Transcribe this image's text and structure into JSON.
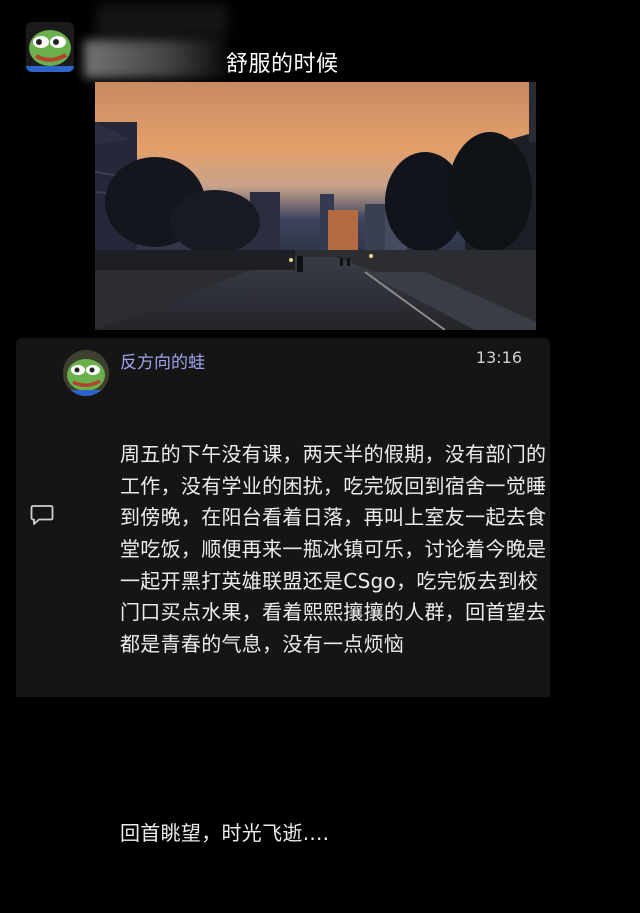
{
  "post": {
    "title_fragment": "舒服的时候",
    "avatar_icon": "pepe-frog-avatar"
  },
  "photo": {
    "description_icon": "sunset-campus-photo"
  },
  "comment": {
    "author": "反方向的蛙",
    "time": "13:16",
    "avatar_icon": "pepe-frog-avatar",
    "action_icon": "comment-icon",
    "paragraphs": [
      "周五的下午没有课，两天半的假期，没有部门的工作，没有学业的困扰，吃完饭回到宿舍一觉睡到傍晚，在阳台看着日落，再叫上室友一起去食堂吃饭，顺便再来一瓶冰镇可乐，讨论着今晚是一起开黑打英雄联盟还是CSgo，吃完饭去到校门口买点水果，看着熙熙攘攘的人群，回首望去都是青春的气息，没有一点烦恼",
      "回首眺望，时光飞逝...."
    ]
  },
  "colors": {
    "background": "#000000",
    "card": "#151515",
    "author": "#9ea2ea",
    "text": "#ececec"
  }
}
